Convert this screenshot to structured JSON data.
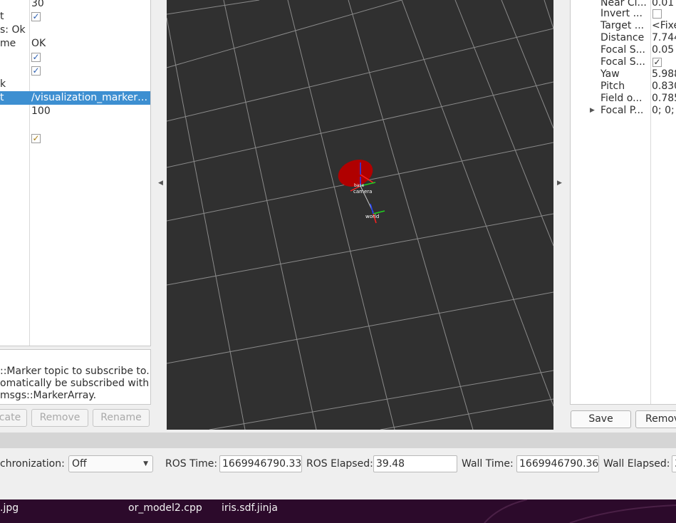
{
  "displays": {
    "rows": [
      {
        "key": "",
        "value": "30",
        "check": null,
        "selected": false
      },
      {
        "key": "t",
        "value": "",
        "check": "blue",
        "selected": false
      },
      {
        "key": "s: Ok",
        "value": "",
        "check": null,
        "selected": false
      },
      {
        "key": "me",
        "value": "OK",
        "check": null,
        "selected": false
      },
      {
        "key": "",
        "value": "",
        "check": "blue",
        "selected": false
      },
      {
        "key": "",
        "value": "",
        "check": "blue",
        "selected": false
      },
      {
        "key": "k",
        "value": "",
        "check": null,
        "selected": false
      },
      {
        "key": "t",
        "value": "/visualization_marker…",
        "check": null,
        "selected": true
      },
      {
        "key": "",
        "value": "100",
        "check": null,
        "selected": false
      },
      {
        "key": "",
        "value": "",
        "check": null,
        "selected": false
      },
      {
        "key": "",
        "value": "",
        "check": "yellow",
        "selected": false
      }
    ],
    "description_lines": [
      "::Marker topic to subscribe to.",
      "omatically be subscribed with",
      "msgs::MarkerArray."
    ],
    "buttons": {
      "duplicate": "cate",
      "remove": "Remove",
      "rename": "Rename"
    }
  },
  "viewport": {
    "background": "#303030",
    "grid_color": "#8a8a8a",
    "frames": {
      "camera": "camera",
      "world": "world",
      "base": "base"
    },
    "marker_color": "#b00000"
  },
  "views": {
    "properties": [
      {
        "key": "Near Cl...",
        "value": "0.01",
        "check": null,
        "expandable": false
      },
      {
        "key": "Invert ...",
        "value": "",
        "check": "empty",
        "expandable": false
      },
      {
        "key": "Target ...",
        "value": "<Fixe",
        "check": null,
        "expandable": false
      },
      {
        "key": "Distance",
        "value": "7.744",
        "check": null,
        "expandable": false
      },
      {
        "key": "Focal S...",
        "value": "0.05",
        "check": null,
        "expandable": false
      },
      {
        "key": "Focal S...",
        "value": "",
        "check": "checked",
        "expandable": false
      },
      {
        "key": "Yaw",
        "value": "5.988",
        "check": null,
        "expandable": false
      },
      {
        "key": "Pitch",
        "value": "0.830",
        "check": null,
        "expandable": false
      },
      {
        "key": "Field o...",
        "value": "0.785",
        "check": null,
        "expandable": false
      },
      {
        "key": "Focal P...",
        "value": "0; 0; 0",
        "check": null,
        "expandable": true
      }
    ],
    "buttons": {
      "save": "Save",
      "remove": "Remov"
    }
  },
  "time": {
    "sync_label": "chronization:",
    "sync_value": "Off",
    "ros_time_label": "ROS Time:",
    "ros_time": "1669946790.33",
    "ros_elapsed_label": "ROS Elapsed:",
    "ros_elapsed": "39.48",
    "wall_time_label": "Wall Time:",
    "wall_time": "1669946790.36",
    "wall_elapsed_label": "Wall Elapsed:",
    "wall_elapsed": "3"
  },
  "desktop": {
    "files": [
      {
        "top": "",
        "bottom": ".jpg"
      },
      {
        "top": "",
        "bottom": "or_model2.cpp"
      },
      {
        "top": "",
        "bottom": "iris.sdf.jinja"
      }
    ]
  }
}
